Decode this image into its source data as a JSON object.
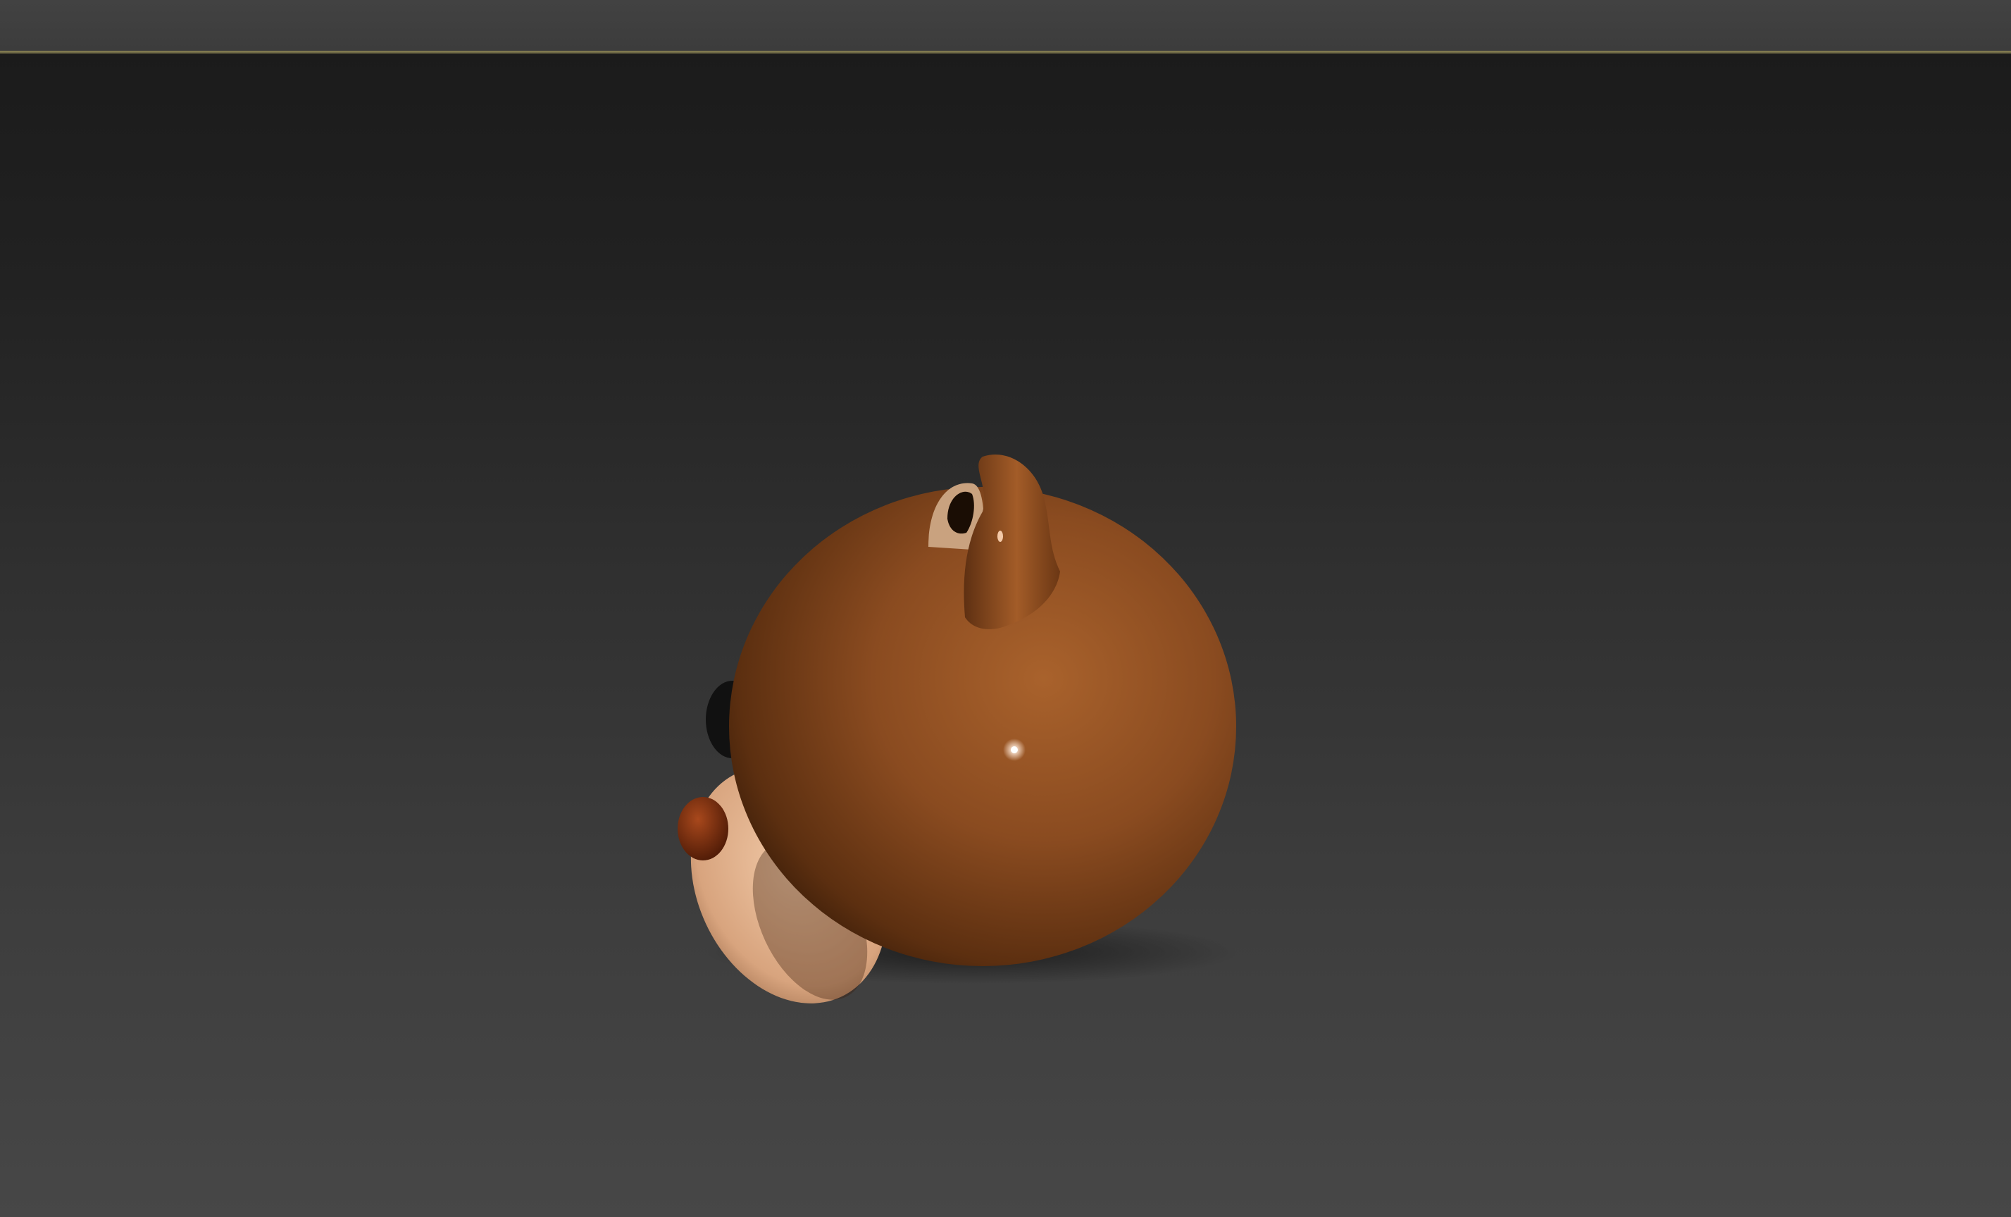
{
  "window": {
    "title": "",
    "accent_color": "#8b8355"
  },
  "viewport": {
    "background_top": "#1b1b1b",
    "background_bottom": "#474747",
    "label": ""
  },
  "scene": {
    "object": "bear-head-model",
    "colors": {
      "fur": "#8a4b20",
      "fur_light": "#a9622c",
      "fur_dark": "#3d1e08",
      "muzzle": "#e2b28f",
      "nose": "#7a2e0e",
      "eye": "#111111",
      "inner_ear": "#c9a27f"
    }
  }
}
